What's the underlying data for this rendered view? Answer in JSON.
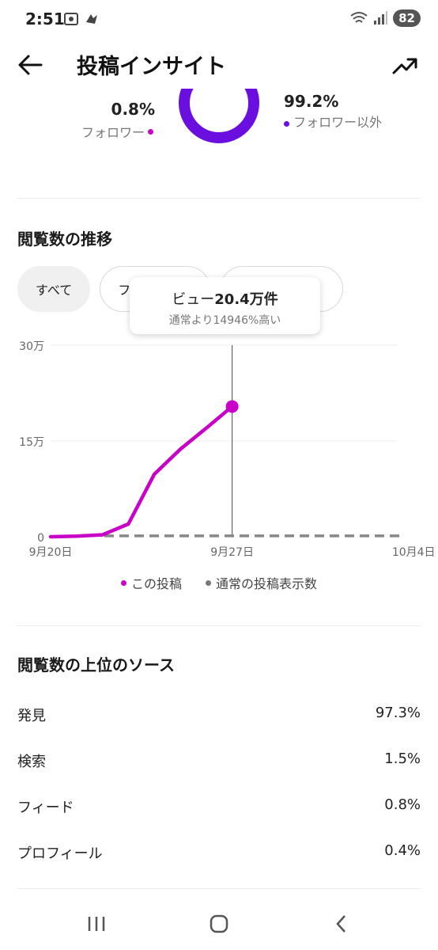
{
  "status_bar": {
    "time": "2:51",
    "battery": "82"
  },
  "header": {
    "title": "投稿インサイト"
  },
  "audience": {
    "followers_pct": "0.8%",
    "followers_label": "フォロワー",
    "non_followers_pct": "99.2%",
    "non_followers_label": "フォロワー以外",
    "followers_color": "#c800c8",
    "non_followers_color": "#6a0fe0"
  },
  "views_trend": {
    "title": "閲覧数の推移",
    "filters": [
      "すべて",
      "フ",
      ""
    ],
    "tooltip_main_prefix": "ビュー",
    "tooltip_main_value": "20.4万件",
    "tooltip_sub": "通常より14946%高い"
  },
  "chart_data": {
    "type": "line",
    "y_tick_labels": [
      "30万",
      "15万",
      "0"
    ],
    "ylim": [
      0,
      300000
    ],
    "x_tick_labels": [
      "9月20日",
      "9月27日",
      "10月4日"
    ],
    "series": [
      {
        "name": "この投稿",
        "color": "#c800c8",
        "x": [
          "9月20日",
          "9月21日",
          "9月22日",
          "9月23日",
          "9月24日",
          "9月25日",
          "9月26日",
          "9月27日"
        ],
        "values": [
          0,
          1000,
          3000,
          20000,
          98000,
          137000,
          170000,
          204000
        ]
      },
      {
        "name": "通常の投稿表示数",
        "color": "#888888",
        "style": "dashed",
        "x": [
          "9月20日",
          "10月4日"
        ],
        "values": [
          1400,
          1400
        ]
      }
    ],
    "highlight": {
      "x": "9月27日",
      "value": 204000
    },
    "grid": true
  },
  "legend": {
    "this_post": "この投稿",
    "typical": "通常の投稿表示数"
  },
  "sources": {
    "title": "閲覧数の上位のソース",
    "rows": [
      {
        "label": "発見",
        "value": "97.3%"
      },
      {
        "label": "検索",
        "value": "1.5%"
      },
      {
        "label": "フィード",
        "value": "0.8%"
      },
      {
        "label": "プロフィール",
        "value": "0.4%"
      }
    ]
  }
}
